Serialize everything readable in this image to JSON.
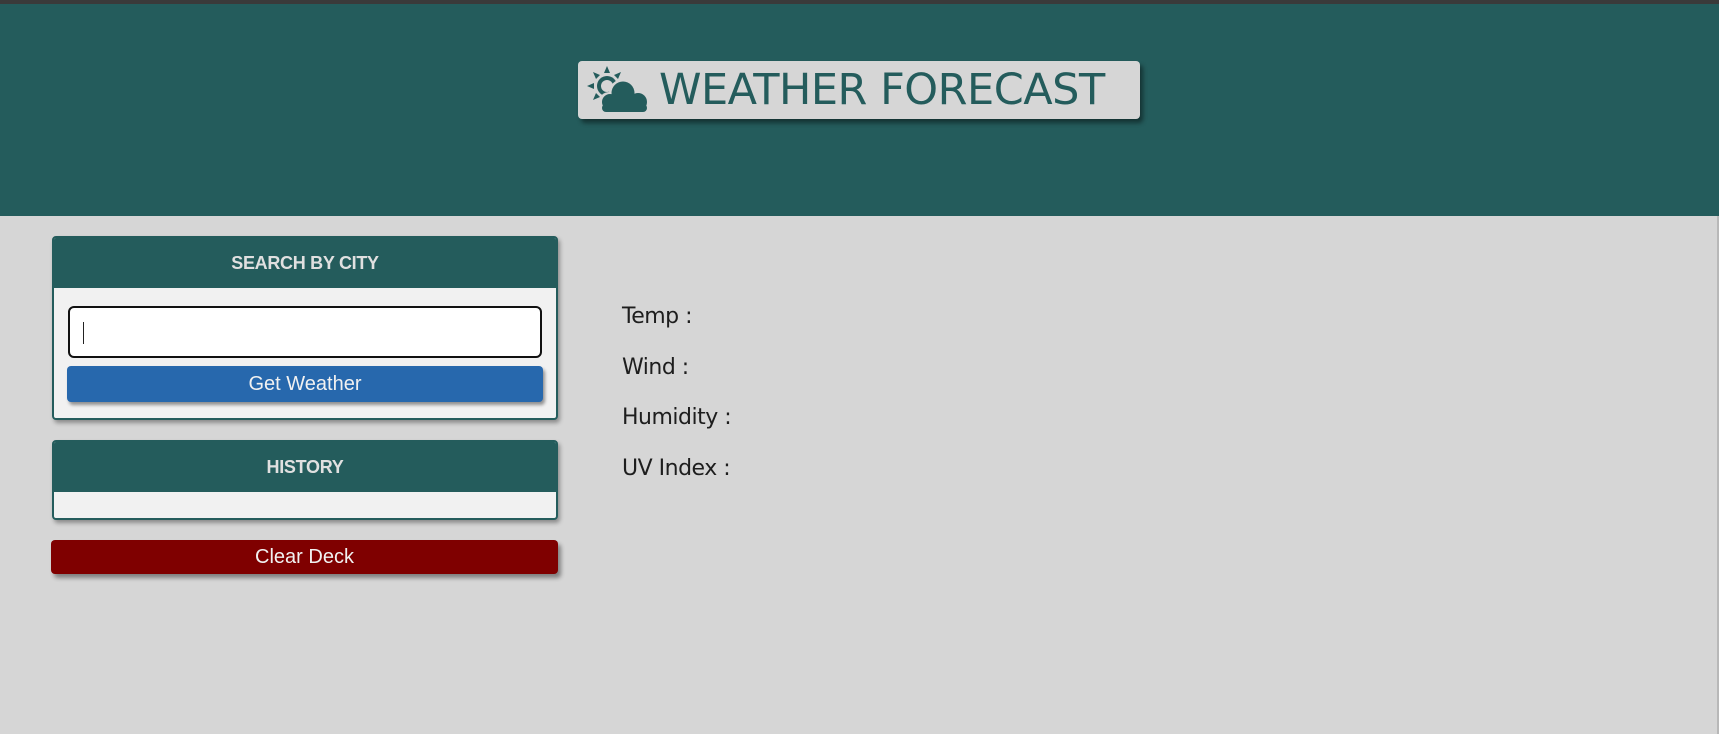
{
  "header": {
    "title": "WEATHER FORECAST",
    "icon": "sun-behind-cloud-icon",
    "background_color": "#245c5c"
  },
  "search": {
    "heading": "SEARCH BY CITY",
    "input_value": "",
    "button_label": "Get Weather",
    "button_color": "#2768ad"
  },
  "history": {
    "heading": "HISTORY",
    "items": []
  },
  "clear": {
    "button_label": "Clear Deck",
    "button_color": "#7f0000"
  },
  "current": {
    "temp_label": "Temp :",
    "wind_label": "Wind :",
    "humidity_label": "Humidity :",
    "uv_label": "UV Index :"
  },
  "colors": {
    "page_background": "#d6d6d6",
    "card_background": "#f1f1f1"
  }
}
